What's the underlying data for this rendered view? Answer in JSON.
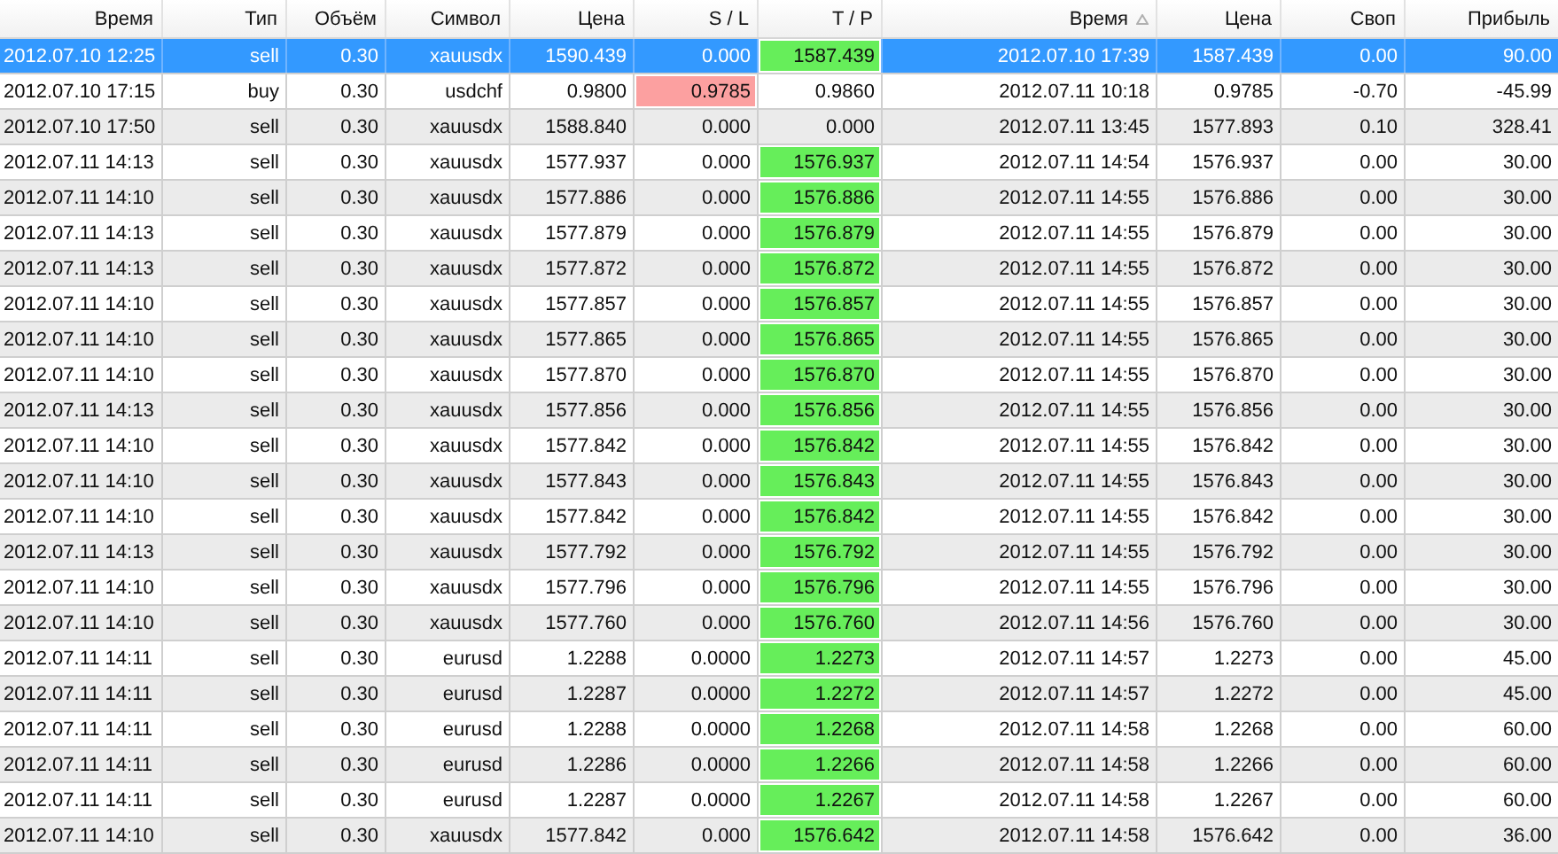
{
  "columns": [
    {
      "label": "Время",
      "sorted": false
    },
    {
      "label": "Тип",
      "sorted": false
    },
    {
      "label": "Объём",
      "sorted": false
    },
    {
      "label": "Символ",
      "sorted": false
    },
    {
      "label": "Цена",
      "sorted": false
    },
    {
      "label": "S / L",
      "sorted": false
    },
    {
      "label": "T / P",
      "sorted": false
    },
    {
      "label": "Время",
      "sorted": true
    },
    {
      "label": "Цена",
      "sorted": false
    },
    {
      "label": "Своп",
      "sorted": false
    },
    {
      "label": "Прибыль",
      "sorted": false
    }
  ],
  "rows": [
    {
      "selected": true,
      "time": "2012.07.10 12:25",
      "type": "sell",
      "volume": "0.30",
      "symbol": "xauusdx",
      "price": "1590.439",
      "sl": "0.000",
      "sl_hit": false,
      "tp": "1587.439",
      "tp_hit": true,
      "close_time": "2012.07.10 17:39",
      "close_price": "1587.439",
      "swap": "0.00",
      "profit": "90.00"
    },
    {
      "selected": false,
      "time": "2012.07.10 17:15",
      "type": "buy",
      "volume": "0.30",
      "symbol": "usdchf",
      "price": "0.9800",
      "sl": "0.9785",
      "sl_hit": true,
      "tp": "0.9860",
      "tp_hit": false,
      "close_time": "2012.07.11 10:18",
      "close_price": "0.9785",
      "swap": "-0.70",
      "profit": "-45.99"
    },
    {
      "selected": false,
      "time": "2012.07.10 17:50",
      "type": "sell",
      "volume": "0.30",
      "symbol": "xauusdx",
      "price": "1588.840",
      "sl": "0.000",
      "sl_hit": false,
      "tp": "0.000",
      "tp_hit": false,
      "close_time": "2012.07.11 13:45",
      "close_price": "1577.893",
      "swap": "0.10",
      "profit": "328.41"
    },
    {
      "selected": false,
      "time": "2012.07.11 14:13",
      "type": "sell",
      "volume": "0.30",
      "symbol": "xauusdx",
      "price": "1577.937",
      "sl": "0.000",
      "sl_hit": false,
      "tp": "1576.937",
      "tp_hit": true,
      "close_time": "2012.07.11 14:54",
      "close_price": "1576.937",
      "swap": "0.00",
      "profit": "30.00"
    },
    {
      "selected": false,
      "time": "2012.07.11 14:10",
      "type": "sell",
      "volume": "0.30",
      "symbol": "xauusdx",
      "price": "1577.886",
      "sl": "0.000",
      "sl_hit": false,
      "tp": "1576.886",
      "tp_hit": true,
      "close_time": "2012.07.11 14:55",
      "close_price": "1576.886",
      "swap": "0.00",
      "profit": "30.00"
    },
    {
      "selected": false,
      "time": "2012.07.11 14:13",
      "type": "sell",
      "volume": "0.30",
      "symbol": "xauusdx",
      "price": "1577.879",
      "sl": "0.000",
      "sl_hit": false,
      "tp": "1576.879",
      "tp_hit": true,
      "close_time": "2012.07.11 14:55",
      "close_price": "1576.879",
      "swap": "0.00",
      "profit": "30.00"
    },
    {
      "selected": false,
      "time": "2012.07.11 14:13",
      "type": "sell",
      "volume": "0.30",
      "symbol": "xauusdx",
      "price": "1577.872",
      "sl": "0.000",
      "sl_hit": false,
      "tp": "1576.872",
      "tp_hit": true,
      "close_time": "2012.07.11 14:55",
      "close_price": "1576.872",
      "swap": "0.00",
      "profit": "30.00"
    },
    {
      "selected": false,
      "time": "2012.07.11 14:10",
      "type": "sell",
      "volume": "0.30",
      "symbol": "xauusdx",
      "price": "1577.857",
      "sl": "0.000",
      "sl_hit": false,
      "tp": "1576.857",
      "tp_hit": true,
      "close_time": "2012.07.11 14:55",
      "close_price": "1576.857",
      "swap": "0.00",
      "profit": "30.00"
    },
    {
      "selected": false,
      "time": "2012.07.11 14:10",
      "type": "sell",
      "volume": "0.30",
      "symbol": "xauusdx",
      "price": "1577.865",
      "sl": "0.000",
      "sl_hit": false,
      "tp": "1576.865",
      "tp_hit": true,
      "close_time": "2012.07.11 14:55",
      "close_price": "1576.865",
      "swap": "0.00",
      "profit": "30.00"
    },
    {
      "selected": false,
      "time": "2012.07.11 14:10",
      "type": "sell",
      "volume": "0.30",
      "symbol": "xauusdx",
      "price": "1577.870",
      "sl": "0.000",
      "sl_hit": false,
      "tp": "1576.870",
      "tp_hit": true,
      "close_time": "2012.07.11 14:55",
      "close_price": "1576.870",
      "swap": "0.00",
      "profit": "30.00"
    },
    {
      "selected": false,
      "time": "2012.07.11 14:13",
      "type": "sell",
      "volume": "0.30",
      "symbol": "xauusdx",
      "price": "1577.856",
      "sl": "0.000",
      "sl_hit": false,
      "tp": "1576.856",
      "tp_hit": true,
      "close_time": "2012.07.11 14:55",
      "close_price": "1576.856",
      "swap": "0.00",
      "profit": "30.00"
    },
    {
      "selected": false,
      "time": "2012.07.11 14:10",
      "type": "sell",
      "volume": "0.30",
      "symbol": "xauusdx",
      "price": "1577.842",
      "sl": "0.000",
      "sl_hit": false,
      "tp": "1576.842",
      "tp_hit": true,
      "close_time": "2012.07.11 14:55",
      "close_price": "1576.842",
      "swap": "0.00",
      "profit": "30.00"
    },
    {
      "selected": false,
      "time": "2012.07.11 14:10",
      "type": "sell",
      "volume": "0.30",
      "symbol": "xauusdx",
      "price": "1577.843",
      "sl": "0.000",
      "sl_hit": false,
      "tp": "1576.843",
      "tp_hit": true,
      "close_time": "2012.07.11 14:55",
      "close_price": "1576.843",
      "swap": "0.00",
      "profit": "30.00"
    },
    {
      "selected": false,
      "time": "2012.07.11 14:10",
      "type": "sell",
      "volume": "0.30",
      "symbol": "xauusdx",
      "price": "1577.842",
      "sl": "0.000",
      "sl_hit": false,
      "tp": "1576.842",
      "tp_hit": true,
      "close_time": "2012.07.11 14:55",
      "close_price": "1576.842",
      "swap": "0.00",
      "profit": "30.00"
    },
    {
      "selected": false,
      "time": "2012.07.11 14:13",
      "type": "sell",
      "volume": "0.30",
      "symbol": "xauusdx",
      "price": "1577.792",
      "sl": "0.000",
      "sl_hit": false,
      "tp": "1576.792",
      "tp_hit": true,
      "close_time": "2012.07.11 14:55",
      "close_price": "1576.792",
      "swap": "0.00",
      "profit": "30.00"
    },
    {
      "selected": false,
      "time": "2012.07.11 14:10",
      "type": "sell",
      "volume": "0.30",
      "symbol": "xauusdx",
      "price": "1577.796",
      "sl": "0.000",
      "sl_hit": false,
      "tp": "1576.796",
      "tp_hit": true,
      "close_time": "2012.07.11 14:55",
      "close_price": "1576.796",
      "swap": "0.00",
      "profit": "30.00"
    },
    {
      "selected": false,
      "time": "2012.07.11 14:10",
      "type": "sell",
      "volume": "0.30",
      "symbol": "xauusdx",
      "price": "1577.760",
      "sl": "0.000",
      "sl_hit": false,
      "tp": "1576.760",
      "tp_hit": true,
      "close_time": "2012.07.11 14:56",
      "close_price": "1576.760",
      "swap": "0.00",
      "profit": "30.00"
    },
    {
      "selected": false,
      "time": "2012.07.11 14:11",
      "type": "sell",
      "volume": "0.30",
      "symbol": "eurusd",
      "price": "1.2288",
      "sl": "0.0000",
      "sl_hit": false,
      "tp": "1.2273",
      "tp_hit": true,
      "close_time": "2012.07.11 14:57",
      "close_price": "1.2273",
      "swap": "0.00",
      "profit": "45.00"
    },
    {
      "selected": false,
      "time": "2012.07.11 14:11",
      "type": "sell",
      "volume": "0.30",
      "symbol": "eurusd",
      "price": "1.2287",
      "sl": "0.0000",
      "sl_hit": false,
      "tp": "1.2272",
      "tp_hit": true,
      "close_time": "2012.07.11 14:57",
      "close_price": "1.2272",
      "swap": "0.00",
      "profit": "45.00"
    },
    {
      "selected": false,
      "time": "2012.07.11 14:11",
      "type": "sell",
      "volume": "0.30",
      "symbol": "eurusd",
      "price": "1.2288",
      "sl": "0.0000",
      "sl_hit": false,
      "tp": "1.2268",
      "tp_hit": true,
      "close_time": "2012.07.11 14:58",
      "close_price": "1.2268",
      "swap": "0.00",
      "profit": "60.00"
    },
    {
      "selected": false,
      "time": "2012.07.11 14:11",
      "type": "sell",
      "volume": "0.30",
      "symbol": "eurusd",
      "price": "1.2286",
      "sl": "0.0000",
      "sl_hit": false,
      "tp": "1.2266",
      "tp_hit": true,
      "close_time": "2012.07.11 14:58",
      "close_price": "1.2266",
      "swap": "0.00",
      "profit": "60.00"
    },
    {
      "selected": false,
      "time": "2012.07.11 14:11",
      "type": "sell",
      "volume": "0.30",
      "symbol": "eurusd",
      "price": "1.2287",
      "sl": "0.0000",
      "sl_hit": false,
      "tp": "1.2267",
      "tp_hit": true,
      "close_time": "2012.07.11 14:58",
      "close_price": "1.2267",
      "swap": "0.00",
      "profit": "60.00"
    },
    {
      "selected": false,
      "time": "2012.07.11 14:10",
      "type": "sell",
      "volume": "0.30",
      "symbol": "xauusdx",
      "price": "1577.842",
      "sl": "0.000",
      "sl_hit": false,
      "tp": "1576.642",
      "tp_hit": true,
      "close_time": "2012.07.11 14:58",
      "close_price": "1576.642",
      "swap": "0.00",
      "profit": "36.00"
    }
  ]
}
